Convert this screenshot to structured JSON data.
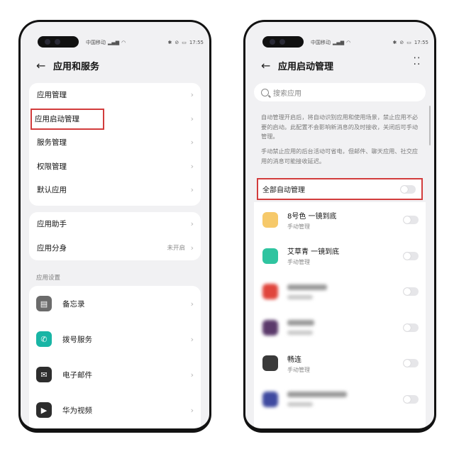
{
  "left": {
    "status": {
      "carrier": "中国移动",
      "time": "17:55"
    },
    "title": "应用和服务",
    "card1": [
      {
        "label": "应用管理"
      },
      {
        "label": "应用启动管理"
      },
      {
        "label": "服务管理"
      },
      {
        "label": "权限管理"
      },
      {
        "label": "默认应用"
      }
    ],
    "card2": [
      {
        "label": "应用助手"
      },
      {
        "label": "应用分身",
        "value": "未开启"
      }
    ],
    "section": "应用设置",
    "apps": [
      {
        "label": "备忘录",
        "icon": "notepad-icon",
        "color": "#6b6b6b"
      },
      {
        "label": "拨号服务",
        "icon": "phone-icon",
        "color": "#19b5a5"
      },
      {
        "label": "电子邮件",
        "icon": "mail-icon",
        "color": "#2d2d2d"
      },
      {
        "label": "华为视频",
        "icon": "video-icon",
        "color": "#2d2d2d"
      }
    ]
  },
  "right": {
    "status": {
      "carrier": "中国移动",
      "time": "17:55"
    },
    "title": "应用启动管理",
    "search_placeholder": "搜索应用",
    "desc1": "自动管理开启后，将自动识别应用和使用场景，禁止应用不必要的启动。此配置不会影响新消息的及时接收，关闭后可手动管理。",
    "desc2": "手动禁止应用的后台活动可省电，但邮件、聊天应用、社交应用的消息可能接收延迟。",
    "all_label": "全部自动管理",
    "apps": [
      {
        "name": "8号色 一镜到底",
        "sub": "手动管理",
        "color": "#f6c96a",
        "blurred": false
      },
      {
        "name": "艾草青 一镜到底",
        "sub": "手动管理",
        "color": "#2fc4a0",
        "blurred": false
      },
      {
        "name": "",
        "sub": "",
        "color": "#e0453c",
        "blurred": true
      },
      {
        "name": "",
        "sub": "",
        "color": "#5b3a6b",
        "blurred": true
      },
      {
        "name": "畅连",
        "sub": "手动管理",
        "color": "#3a3a3a",
        "blurred": false
      },
      {
        "name": "",
        "sub": "",
        "color": "#3f4aa0",
        "blurred": true
      }
    ]
  }
}
